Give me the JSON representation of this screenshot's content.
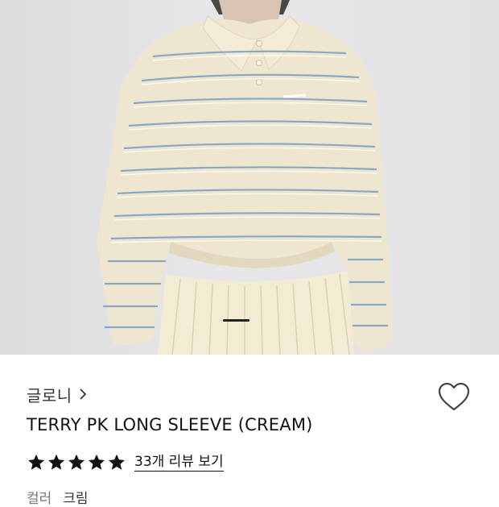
{
  "product": {
    "brand": "글로니",
    "title": "TERRY PK LONG SLEEVE (CREAM)",
    "rating_stars": 5,
    "review_link": "33개 리뷰 보기",
    "option_label": "컬러",
    "option_value": "크림"
  },
  "gallery": {
    "image_alt": "Model wearing cream striped long sleeve polo shirt with pleated skirt",
    "current_slide": 1
  },
  "colors": {
    "shirt": "#efe6cf",
    "stripe_blue": "#7fa1c7",
    "star": "#111111"
  },
  "icons": [
    "chevron-right-icon",
    "heart-icon",
    "star-icon"
  ]
}
